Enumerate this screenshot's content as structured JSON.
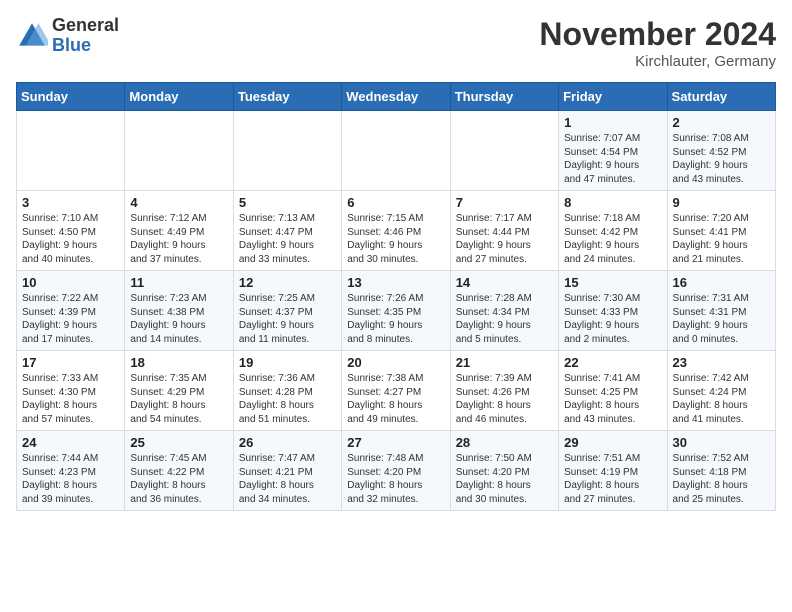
{
  "header": {
    "logo_general": "General",
    "logo_blue": "Blue",
    "month_title": "November 2024",
    "location": "Kirchlauter, Germany"
  },
  "calendar": {
    "days_of_week": [
      "Sunday",
      "Monday",
      "Tuesday",
      "Wednesday",
      "Thursday",
      "Friday",
      "Saturday"
    ],
    "weeks": [
      [
        {
          "day": "",
          "info": ""
        },
        {
          "day": "",
          "info": ""
        },
        {
          "day": "",
          "info": ""
        },
        {
          "day": "",
          "info": ""
        },
        {
          "day": "",
          "info": ""
        },
        {
          "day": "1",
          "info": "Sunrise: 7:07 AM\nSunset: 4:54 PM\nDaylight: 9 hours\nand 47 minutes."
        },
        {
          "day": "2",
          "info": "Sunrise: 7:08 AM\nSunset: 4:52 PM\nDaylight: 9 hours\nand 43 minutes."
        }
      ],
      [
        {
          "day": "3",
          "info": "Sunrise: 7:10 AM\nSunset: 4:50 PM\nDaylight: 9 hours\nand 40 minutes."
        },
        {
          "day": "4",
          "info": "Sunrise: 7:12 AM\nSunset: 4:49 PM\nDaylight: 9 hours\nand 37 minutes."
        },
        {
          "day": "5",
          "info": "Sunrise: 7:13 AM\nSunset: 4:47 PM\nDaylight: 9 hours\nand 33 minutes."
        },
        {
          "day": "6",
          "info": "Sunrise: 7:15 AM\nSunset: 4:46 PM\nDaylight: 9 hours\nand 30 minutes."
        },
        {
          "day": "7",
          "info": "Sunrise: 7:17 AM\nSunset: 4:44 PM\nDaylight: 9 hours\nand 27 minutes."
        },
        {
          "day": "8",
          "info": "Sunrise: 7:18 AM\nSunset: 4:42 PM\nDaylight: 9 hours\nand 24 minutes."
        },
        {
          "day": "9",
          "info": "Sunrise: 7:20 AM\nSunset: 4:41 PM\nDaylight: 9 hours\nand 21 minutes."
        }
      ],
      [
        {
          "day": "10",
          "info": "Sunrise: 7:22 AM\nSunset: 4:39 PM\nDaylight: 9 hours\nand 17 minutes."
        },
        {
          "day": "11",
          "info": "Sunrise: 7:23 AM\nSunset: 4:38 PM\nDaylight: 9 hours\nand 14 minutes."
        },
        {
          "day": "12",
          "info": "Sunrise: 7:25 AM\nSunset: 4:37 PM\nDaylight: 9 hours\nand 11 minutes."
        },
        {
          "day": "13",
          "info": "Sunrise: 7:26 AM\nSunset: 4:35 PM\nDaylight: 9 hours\nand 8 minutes."
        },
        {
          "day": "14",
          "info": "Sunrise: 7:28 AM\nSunset: 4:34 PM\nDaylight: 9 hours\nand 5 minutes."
        },
        {
          "day": "15",
          "info": "Sunrise: 7:30 AM\nSunset: 4:33 PM\nDaylight: 9 hours\nand 2 minutes."
        },
        {
          "day": "16",
          "info": "Sunrise: 7:31 AM\nSunset: 4:31 PM\nDaylight: 9 hours\nand 0 minutes."
        }
      ],
      [
        {
          "day": "17",
          "info": "Sunrise: 7:33 AM\nSunset: 4:30 PM\nDaylight: 8 hours\nand 57 minutes."
        },
        {
          "day": "18",
          "info": "Sunrise: 7:35 AM\nSunset: 4:29 PM\nDaylight: 8 hours\nand 54 minutes."
        },
        {
          "day": "19",
          "info": "Sunrise: 7:36 AM\nSunset: 4:28 PM\nDaylight: 8 hours\nand 51 minutes."
        },
        {
          "day": "20",
          "info": "Sunrise: 7:38 AM\nSunset: 4:27 PM\nDaylight: 8 hours\nand 49 minutes."
        },
        {
          "day": "21",
          "info": "Sunrise: 7:39 AM\nSunset: 4:26 PM\nDaylight: 8 hours\nand 46 minutes."
        },
        {
          "day": "22",
          "info": "Sunrise: 7:41 AM\nSunset: 4:25 PM\nDaylight: 8 hours\nand 43 minutes."
        },
        {
          "day": "23",
          "info": "Sunrise: 7:42 AM\nSunset: 4:24 PM\nDaylight: 8 hours\nand 41 minutes."
        }
      ],
      [
        {
          "day": "24",
          "info": "Sunrise: 7:44 AM\nSunset: 4:23 PM\nDaylight: 8 hours\nand 39 minutes."
        },
        {
          "day": "25",
          "info": "Sunrise: 7:45 AM\nSunset: 4:22 PM\nDaylight: 8 hours\nand 36 minutes."
        },
        {
          "day": "26",
          "info": "Sunrise: 7:47 AM\nSunset: 4:21 PM\nDaylight: 8 hours\nand 34 minutes."
        },
        {
          "day": "27",
          "info": "Sunrise: 7:48 AM\nSunset: 4:20 PM\nDaylight: 8 hours\nand 32 minutes."
        },
        {
          "day": "28",
          "info": "Sunrise: 7:50 AM\nSunset: 4:20 PM\nDaylight: 8 hours\nand 30 minutes."
        },
        {
          "day": "29",
          "info": "Sunrise: 7:51 AM\nSunset: 4:19 PM\nDaylight: 8 hours\nand 27 minutes."
        },
        {
          "day": "30",
          "info": "Sunrise: 7:52 AM\nSunset: 4:18 PM\nDaylight: 8 hours\nand 25 minutes."
        }
      ]
    ]
  }
}
